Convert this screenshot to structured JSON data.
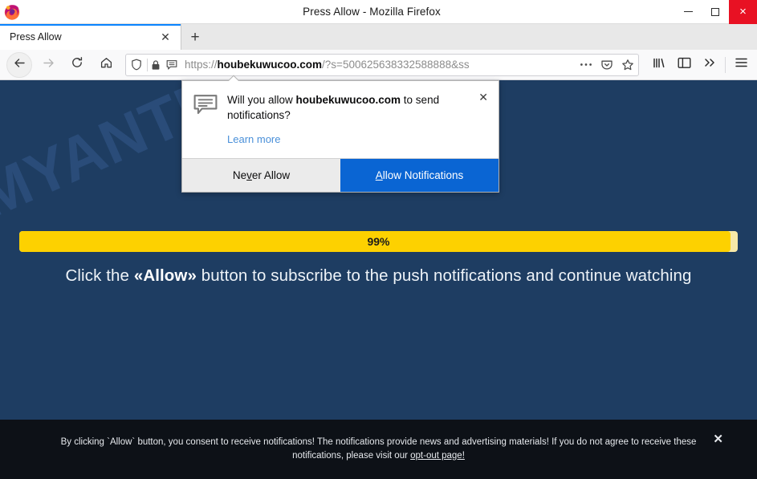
{
  "window": {
    "title": "Press Allow - Mozilla Firefox",
    "logo_icon": "firefox-logo",
    "controls": {
      "minimize": "minimize-icon",
      "maximize": "maximize-icon",
      "close": "×"
    }
  },
  "tabs": {
    "items": [
      {
        "label": "Press Allow",
        "close": "✕"
      }
    ],
    "new_tab": "+"
  },
  "toolbar": {
    "back_icon": "back-arrow-icon",
    "forward_icon": "forward-arrow-icon",
    "reload_icon": "reload-icon",
    "home_icon": "home-icon",
    "page_actions_icon": "ellipsis-icon",
    "pocket_icon": "pocket-icon",
    "bookmark_icon": "star-icon",
    "library_icon": "library-icon",
    "sidebar_icon": "sidebar-icon",
    "overflow_icon": "»",
    "menu_icon": "hamburger-menu-icon"
  },
  "urlbar": {
    "tracking_shield_icon": "shield-icon",
    "lock_icon": "padlock-icon",
    "permission_icon": "notification-bubble-icon",
    "scheme": "https://",
    "host": "houbekuwucoo.com",
    "path": "/?s=500625638332588888&ss",
    "full_url": "https://houbekuwucoo.com/?s=500625638332588888&ss"
  },
  "notification_popup": {
    "icon": "notification-bubble-icon",
    "question_prefix": "Will you allow ",
    "question_domain": "houbekuwucoo.com",
    "question_suffix": " to send notifications?",
    "learn_more": "Learn more",
    "close": "✕",
    "deny_button": {
      "prefix": "Ne",
      "accel": "v",
      "suffix": "er Allow"
    },
    "allow_button": {
      "accel": "A",
      "suffix": "llow Notifications"
    },
    "accent_color": "#0a65d3"
  },
  "page": {
    "background_color": "#1e3d62",
    "watermark": "MYANTISPYWARE.COM",
    "progress": {
      "percent_label": "99%",
      "percent_value": 99,
      "fill_color": "#fdd100",
      "track_color": "#f7e9a8"
    },
    "cta": {
      "before": "Click the ",
      "highlight": "«Allow»",
      "after": " button to subscribe to the push notifications and continue watching"
    }
  },
  "consent_banner": {
    "background_color": "#0d1117",
    "line1": "By clicking `Allow` button, you consent to receive notifications! The notifications provide news and advertising materials! If you do not agree to receive these",
    "line2_before": "notifications, please visit our ",
    "line2_link": "opt-out page!",
    "close": "✕"
  }
}
